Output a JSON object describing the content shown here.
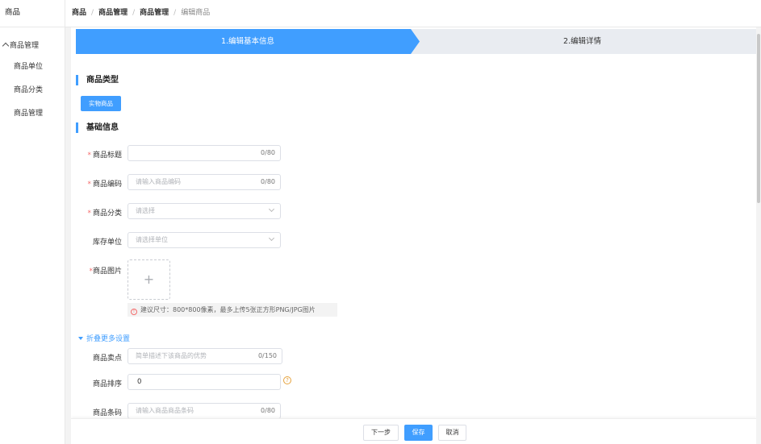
{
  "sidebar": {
    "title": "商品",
    "group_label": "商品管理",
    "items": [
      {
        "label": "商品单位"
      },
      {
        "label": "商品分类"
      },
      {
        "label": "商品管理"
      }
    ]
  },
  "breadcrumb": {
    "items": [
      "商品",
      "商品管理",
      "商品管理"
    ],
    "current": "编辑商品",
    "separator": "/"
  },
  "steps": {
    "step1": "1.编辑基本信息",
    "step2": "2.编辑详情"
  },
  "sections": {
    "type_title": "商品类型",
    "type_button": "实物商品",
    "basic_title": "基础信息"
  },
  "form": {
    "title": {
      "label": "商品标题",
      "placeholder": "",
      "count": "0/80"
    },
    "code": {
      "label": "商品编码",
      "placeholder": "请输入商品编码",
      "count": "0/80"
    },
    "category": {
      "label": "商品分类",
      "placeholder": "请选择"
    },
    "unit": {
      "label": "库存单位",
      "placeholder": "请选择单位"
    },
    "image": {
      "label": "商品图片",
      "plus": "+"
    },
    "image_tip": "建议尺寸：800*800像素，最多上传5张正方形PNG/JPG图片",
    "required_mark": "*"
  },
  "more": {
    "toggle_label": "折叠更多设置",
    "selling_point": {
      "label": "商品卖点",
      "placeholder": "简单描述下该商品的优势",
      "count": "0/150"
    },
    "sort": {
      "label": "商品排序",
      "value": "0",
      "help": "?"
    },
    "barcode": {
      "label": "商品条码",
      "placeholder": "请输入商品商品条码",
      "count": "0/80"
    }
  },
  "footer": {
    "next": "下一步",
    "save": "保存",
    "cancel": "取消"
  },
  "colors": {
    "primary": "#409eff",
    "required": "#f56c6c",
    "warning": "#e6a23c"
  }
}
